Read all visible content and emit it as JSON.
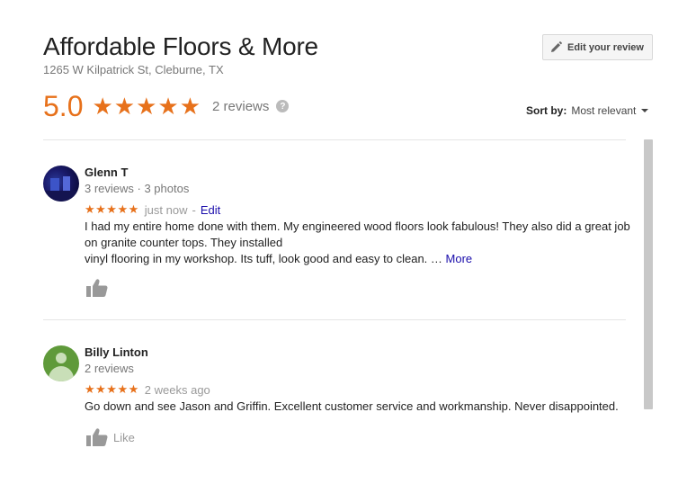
{
  "business": {
    "name": "Affordable Floors & More",
    "address": "1265 W Kilpatrick St, Cleburne, TX",
    "rating": "5.0",
    "stars": "★★★★★",
    "review_count": "2 reviews",
    "help_glyph": "?"
  },
  "toolbar": {
    "edit_review_label": "Edit your review"
  },
  "sort": {
    "label": "Sort by:",
    "value": "Most relevant"
  },
  "reviews": [
    {
      "name": "Glenn T",
      "meta": "3 reviews · 3 photos",
      "stars": "★★★★★",
      "time": "just now",
      "separator": "-",
      "edit_label": "Edit",
      "text_line1": "I had my entire home done with them. My engineered wood floors look fabulous! They also did a great job on granite counter tops. They installed",
      "text_line2": "vinyl flooring in my workshop. Its tuff, look good and easy to clean. … ",
      "more_label": "More"
    },
    {
      "name": "Billy Linton",
      "meta": "2 reviews",
      "stars": "★★★★★",
      "time": "2 weeks ago",
      "text_line1": "Go down and see Jason and Griffin. Excellent customer service and workmanship. Never disappointed.",
      "like_label": "Like"
    }
  ],
  "colors": {
    "accent": "#e7711b",
    "link": "#1a0dab"
  }
}
